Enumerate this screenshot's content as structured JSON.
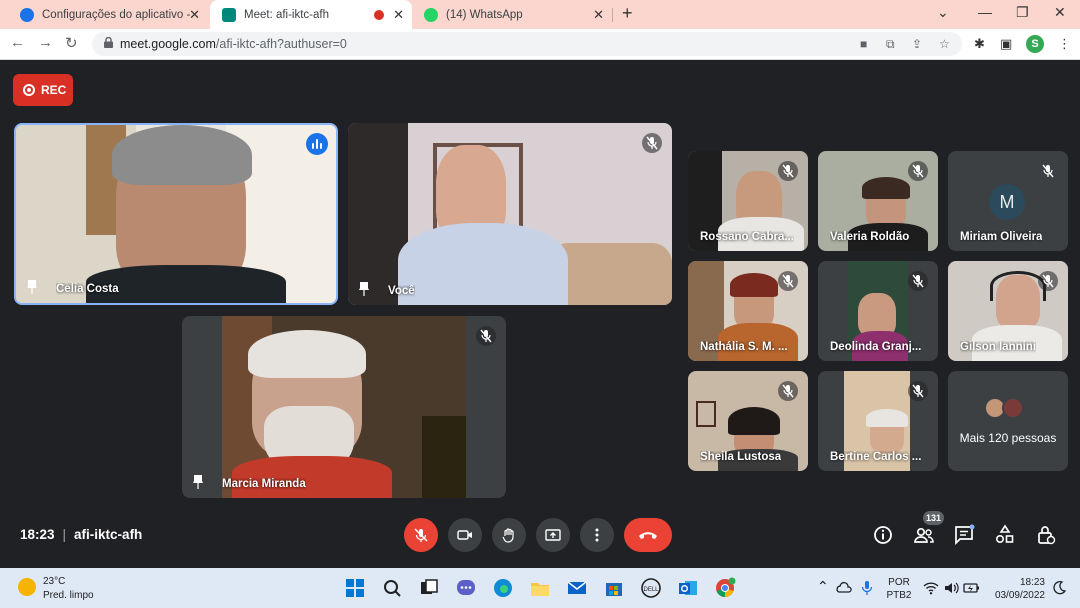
{
  "browser": {
    "tabs": [
      {
        "title": "Configurações do aplicativo - Ad",
        "favicon_color": "#1a73e8",
        "active": false
      },
      {
        "title": "Meet: afi-iktc-afh",
        "favicon_color": "#00897b",
        "active": true,
        "recording": true
      },
      {
        "title": "(14) WhatsApp",
        "favicon_color": "#25d366",
        "active": false
      }
    ],
    "close_glyph": "✕",
    "new_tab_glyph": "+",
    "url_host": "meet.google.com",
    "url_path": "/afi-iktc-afh?authuser=0",
    "profile_initial": "S"
  },
  "meeting": {
    "rec_label": "REC",
    "code": "afi-iktc-afh",
    "time": "18:23",
    "participant_count": "131",
    "tiles": [
      {
        "name": "Celia Costa",
        "pinned": true,
        "speaking": true
      },
      {
        "name": "Você",
        "pinned": true,
        "muted": true
      },
      {
        "name": "Marcia Miranda",
        "pinned": true,
        "muted": true
      },
      {
        "name": "Rossano Cabra...",
        "muted": true
      },
      {
        "name": "Valeria Roldão",
        "muted": true
      },
      {
        "name": "Miriam Oliveira",
        "muted": true,
        "avatar_letter": "M"
      },
      {
        "name": "Nathália S. M. ...",
        "muted": true
      },
      {
        "name": "Deolinda Granj...",
        "muted": true
      },
      {
        "name": "Gilson Iannini",
        "muted": true
      },
      {
        "name": "Sheila Lustosa",
        "muted": true
      },
      {
        "name": "Bertine Carlos ...",
        "muted": true
      },
      {
        "name": "Mais 120 pessoas"
      }
    ]
  },
  "taskbar": {
    "temperature": "23°C",
    "condition": "Pred. limpo",
    "lang_1": "POR",
    "lang_2": "PTB2",
    "clock_time": "18:23",
    "clock_date": "03/09/2022"
  },
  "colors": {
    "meet_bg": "#202124",
    "tile_bg": "#3c4043",
    "red": "#ea4335",
    "speaking_blue": "#1a73e8",
    "tabstrip": "#fbd6ce"
  }
}
